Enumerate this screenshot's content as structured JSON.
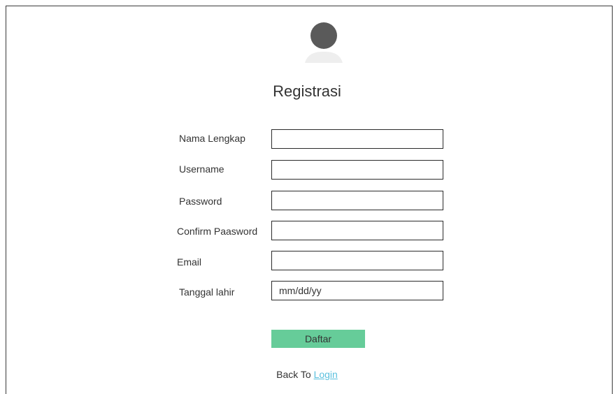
{
  "form": {
    "title": "Registrasi",
    "fields": [
      {
        "label": "Nama Lengkap",
        "value": "",
        "placeholder": ""
      },
      {
        "label": "Username",
        "value": "",
        "placeholder": ""
      },
      {
        "label": "Password",
        "value": "",
        "placeholder": ""
      },
      {
        "label": "Confirm Paasword",
        "value": "",
        "placeholder": ""
      },
      {
        "label": "Email",
        "value": "",
        "placeholder": ""
      },
      {
        "label": "Tanggal lahir",
        "value": "",
        "placeholder": "mm/dd/yy"
      }
    ],
    "submit_label": "Daftar"
  },
  "footer": {
    "prefix": "Back To",
    "link_label": "Login"
  },
  "icons": {
    "avatar": "user-avatar-icon"
  },
  "colors": {
    "submit_background": "#66cc99",
    "link": "#5bc0de",
    "avatar": "#5a5a5a"
  }
}
